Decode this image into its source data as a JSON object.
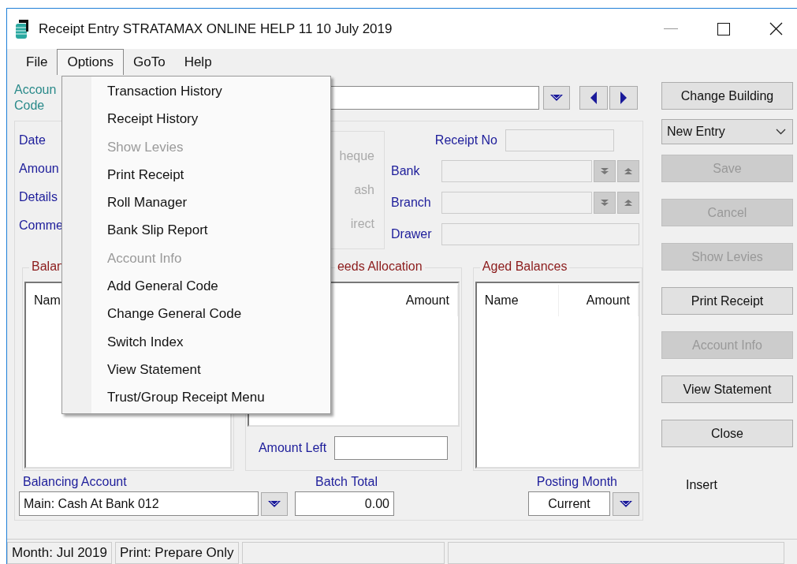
{
  "window": {
    "title": "Receipt Entry STRATAMAX ONLINE HELP 11 10 July 2019"
  },
  "menu_bar": [
    {
      "label": "File",
      "selected": false
    },
    {
      "label": "Options",
      "selected": true
    },
    {
      "label": "GoTo",
      "selected": false
    },
    {
      "label": "Help",
      "selected": false
    }
  ],
  "options_menu": {
    "items": [
      {
        "label": "Transaction History",
        "disabled": false
      },
      {
        "label": "Receipt History",
        "disabled": false
      },
      {
        "label": "Show Levies",
        "disabled": true
      },
      {
        "label": "Print Receipt",
        "disabled": false
      },
      {
        "label": "Roll Manager",
        "disabled": false
      },
      {
        "label": "Bank Slip Report",
        "disabled": false
      },
      {
        "label": "Account Info",
        "disabled": true
      },
      {
        "label": "Add General Code",
        "disabled": false
      },
      {
        "label": "Change General Code",
        "disabled": false
      },
      {
        "label": "Switch Index",
        "disabled": false
      },
      {
        "label": "View Statement",
        "disabled": false
      },
      {
        "label": "Trust/Group Receipt Menu",
        "disabled": false
      }
    ]
  },
  "account": {
    "label_lines": [
      "Accoun",
      "Code"
    ]
  },
  "details_labels": [
    "Date",
    "Amoun",
    "Details",
    "Comme"
  ],
  "payment_type": {
    "disabled": true,
    "options": [
      "heque",
      "ash",
      "irect"
    ]
  },
  "receipt": {
    "receipt_no_label": "Receipt No",
    "bank_label": "Bank",
    "branch_label": "Branch",
    "drawer_label": "Drawer"
  },
  "balances": {
    "title": "Balan",
    "columns": [
      "Nam"
    ]
  },
  "allocation": {
    "title": "eeds Allocation",
    "columns": [
      "Amount"
    ],
    "amount_left_label": "Amount Left"
  },
  "aged_balances": {
    "title": "Aged Balances",
    "columns": [
      "Name",
      "Amount"
    ]
  },
  "balancing_account": {
    "label": "Balancing Account",
    "value": "Main: Cash At Bank 012"
  },
  "batch_total": {
    "label": "Batch Total",
    "value": "0.00"
  },
  "posting_month": {
    "label": "Posting Month",
    "value": "Current"
  },
  "actions": [
    {
      "kind": "button",
      "label": "Change Building",
      "disabled": false
    },
    {
      "kind": "select",
      "label": "New Entry",
      "disabled": false
    },
    {
      "kind": "button",
      "label": "Save",
      "disabled": true
    },
    {
      "kind": "button",
      "label": "Cancel",
      "disabled": true
    },
    {
      "kind": "button",
      "label": "Show Levies",
      "disabled": true
    },
    {
      "kind": "button",
      "label": "Print Receipt",
      "disabled": false
    },
    {
      "kind": "button",
      "label": "Account Info",
      "disabled": true
    },
    {
      "kind": "button",
      "label": "View Statement",
      "disabled": false
    },
    {
      "kind": "button",
      "label": "Close",
      "disabled": false
    }
  ],
  "mode_indicator": "Insert",
  "status_bar": [
    "Month: Jul 2019",
    "Print: Prepare Only"
  ]
}
